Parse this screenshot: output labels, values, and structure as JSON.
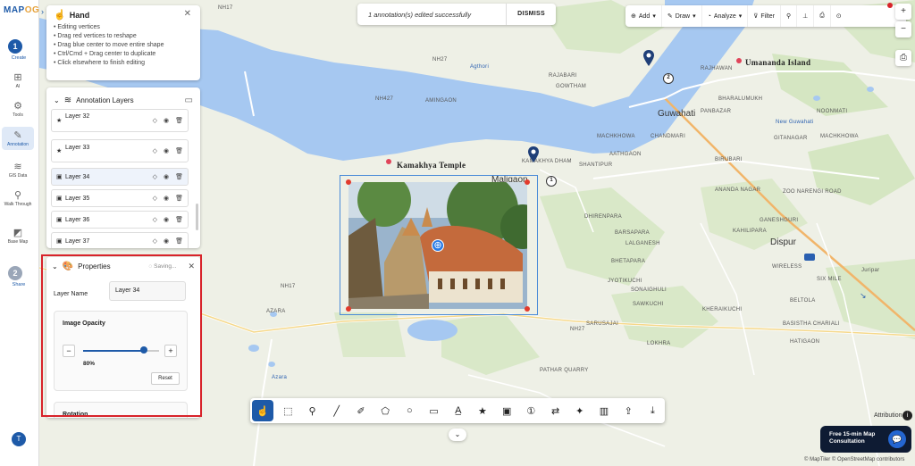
{
  "brand": {
    "logo_main": "MAP",
    "logo_accent": "OG"
  },
  "rail": {
    "step1": {
      "number": "1",
      "label": "Create"
    },
    "items": [
      {
        "label": "AI",
        "icon": "ai-icon"
      },
      {
        "label": "Tools",
        "icon": "gear-icon"
      },
      {
        "label": "Annotation",
        "icon": "annotation-icon"
      },
      {
        "label": "GIS Data",
        "icon": "layers-icon"
      },
      {
        "label": "Walk Through",
        "icon": "walk-icon"
      },
      {
        "label": "Base Map",
        "icon": "basemap-icon"
      }
    ],
    "step2": {
      "number": "2",
      "label": "Share"
    },
    "avatar": "T"
  },
  "hand_panel": {
    "title": "Hand",
    "tips": [
      "• Editing vertices",
      "• Drag red vertices to reshape",
      "• Drag blue center to move entire shape",
      "• Ctrl/Cmd + Drag center to duplicate",
      "• Click elsewhere to finish editing"
    ]
  },
  "layers_panel": {
    "title": "Annotation Layers",
    "rows": [
      {
        "name": "Layer 32",
        "type": "marker"
      },
      {
        "name": "Layer 33",
        "type": "marker"
      },
      {
        "name": "Layer 34",
        "type": "image"
      },
      {
        "name": "Layer 35",
        "type": "image"
      },
      {
        "name": "Layer 36",
        "type": "image"
      },
      {
        "name": "Layer 37",
        "type": "image"
      }
    ]
  },
  "properties": {
    "title": "Properties",
    "status": "Saving...",
    "layer_name_label": "Layer Name",
    "layer_name_value": "Layer 34",
    "opacity_title": "Image Opacity",
    "opacity_value": 0.8,
    "opacity_text": "80%",
    "minus": "−",
    "plus": "+",
    "reset": "Reset",
    "rotation_title": "Rotation"
  },
  "toast": {
    "message": "1 annotation(s) edited successfully",
    "action": "DISMISS"
  },
  "topbar": {
    "add": "Add",
    "draw": "Draw",
    "analyze": "Analyze",
    "filter": "Filter"
  },
  "map_labels": {
    "umananda": "Umananda Island",
    "kamakhya": "Kamakhya Temple",
    "maligaon": "Maligaon",
    "guwahati": "Guwahati",
    "dispur": "Dispur",
    "agthori": "Agthori",
    "amingaon": "AMINGAON",
    "rajabari": "RAJABARI",
    "gowtham": "GOWTHAM",
    "rajhawan": "RAJHAWAN",
    "bharalumukh": "BHARALUMUKH",
    "panbazar": "PANBAZAR",
    "newguwahati": "New Guwahati",
    "noonmati": "NOONMATI",
    "gitanagar": "GITANAGAR",
    "maghkowa": "MACHKHOWA",
    "dham": "KAMAKHYA DHAM",
    "shantipur": "SHANTIPUR",
    "chandmari": "CHANDMARI",
    "aathgaon": "AATHGAON",
    "birubari": "BIRUBARI",
    "dhirenpara": "DHIRENPARA",
    "barsapara": "BARSAPARA",
    "lalganesh": "LALGANESH",
    "bhetapara": "BHETAPARA",
    "jyotikuchi": "JYOTIKUCHI",
    "sonaighuli": "SONAIGHULI",
    "sawkuchi": "SAWKUCHI",
    "kheraikuchi": "KHERAIKUCHI",
    "bhangagarh": "BHANGAGARH",
    "zoo": "ZOO NARENGI ROAD",
    "ganeshguri": "GANESHGURI",
    "anandanagar": "ANANDA NAGAR",
    "kahilipara": "KAHILIPARA",
    "wireless": "WIRELESS",
    "sixmile": "SIX MILE",
    "beltola": "BELTOLA",
    "basistha": "BASISTHA CHARIALI",
    "lokhra": "LOKHRA",
    "bhagaduttapur": "BHAGADUTTAPUR",
    "hatigaon": "HATIGAON",
    "nh17a": "NH17",
    "nh17b": "NH17",
    "nh27a": "NH27",
    "nh27b": "NH27",
    "nh427": "NH427",
    "azara": "AZARA",
    "azara2": "Azara",
    "sarusajai": "SARUSAJAI",
    "mathgharia": "MATHGHARIA",
    "pathar": "PATHAR QUARRY",
    "juripar": "Juripar",
    "wpmb": "WPM Road",
    "route1": "1",
    "route2": "2"
  },
  "attribution": {
    "label": "Attribution",
    "copyright": "© MapTiler © OpenStreetMap contributors"
  },
  "consult": {
    "line1": "Free 15-min Map",
    "line2": "Consultation"
  }
}
